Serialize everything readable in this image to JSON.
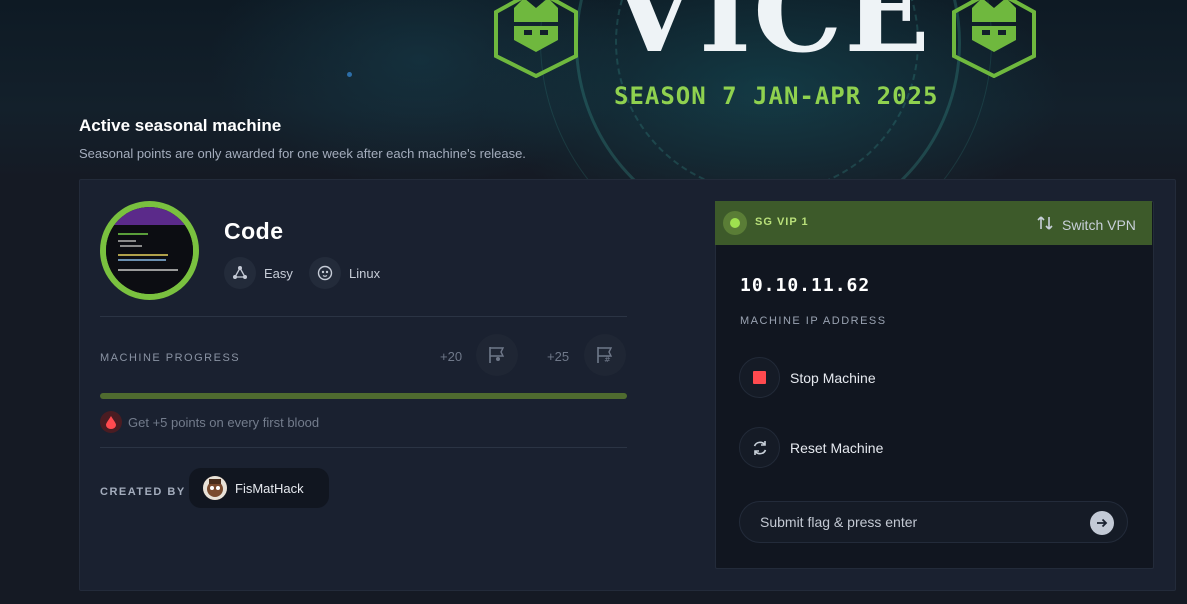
{
  "banner": {
    "title": "VICE",
    "season": "SEASON 7 JAN-APR 2025"
  },
  "section": {
    "title": "Active seasonal machine",
    "subtitle": "Seasonal points are only awarded for one week after each machine's release."
  },
  "machine": {
    "name": "Code",
    "difficulty": "Easy",
    "os": "Linux",
    "difficulty_icon": "difficulty-icon",
    "os_icon": "linux-penguin-icon"
  },
  "progress": {
    "label": "MACHINE PROGRESS",
    "user_points": "+20",
    "root_points": "+25",
    "user_flag_icon": "user-flag-icon",
    "root_flag_icon": "root-flag-icon",
    "fraction": 0
  },
  "first_blood": {
    "text": "Get +5 points on every first blood",
    "icon": "blood-drop-icon"
  },
  "creator": {
    "label": "CREATED BY",
    "name": "FisMatHack"
  },
  "vpn": {
    "server": "SG VIP 1",
    "switch_label": "Switch VPN",
    "status_color": "#9fe04f"
  },
  "ip": {
    "address": "10.10.11.62",
    "label": "MACHINE IP ADDRESS"
  },
  "actions": {
    "stop": "Stop Machine",
    "reset": "Reset Machine"
  },
  "flag": {
    "placeholder": "Submit flag & press enter"
  },
  "colors": {
    "accent": "#9fe04f",
    "card_bg": "#1a2130",
    "page_bg": "#151a24",
    "stop_red": "#ff4a4f",
    "vpn_bar": "#3d5a2a"
  }
}
